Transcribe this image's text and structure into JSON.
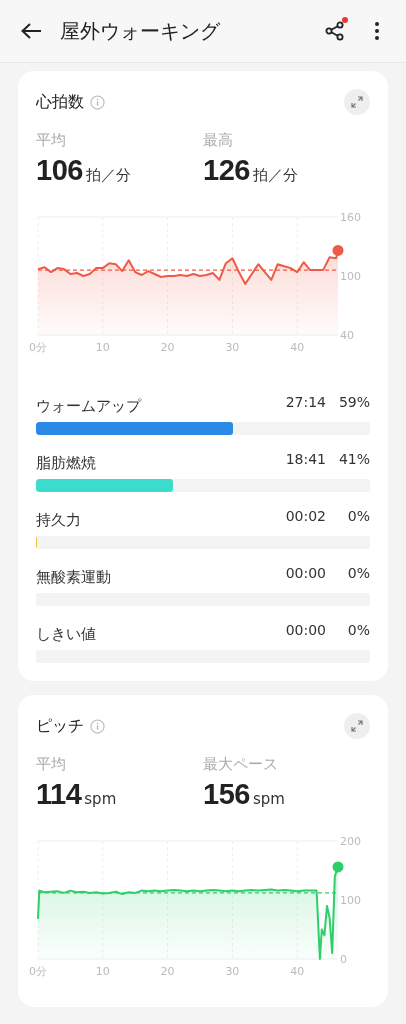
{
  "header": {
    "title": "屋外ウォーキング",
    "share_badge": true
  },
  "cards": [
    {
      "title": "心拍数",
      "stats": [
        {
          "label": "平均",
          "value": "106",
          "unit": "拍／分"
        },
        {
          "label": "最高",
          "value": "126",
          "unit": "拍／分"
        }
      ],
      "chart_data": {
        "type": "area",
        "grid": true,
        "x": [
          0,
          1,
          2,
          3,
          4,
          5,
          6,
          7,
          8,
          9,
          10,
          11,
          12,
          13,
          14,
          15,
          16,
          17,
          18,
          19,
          20,
          21,
          22,
          23,
          24,
          25,
          26,
          27,
          28,
          29,
          30,
          31,
          32,
          33,
          34,
          35,
          36,
          37,
          38,
          39,
          40,
          41,
          42,
          43,
          44,
          45,
          46,
          46.3
        ],
        "xlim": [
          0,
          46.3
        ],
        "ylim": [
          40,
          160
        ],
        "xticks": [
          {
            "value": 0,
            "label": "0分"
          },
          10,
          20,
          30,
          40
        ],
        "yticks": [
          40,
          100,
          160
        ],
        "series": [
          {
            "color": "#ef5a48",
            "values": [
              107,
              109,
              104,
              108,
              107,
              102,
              103,
              100,
              102,
              108,
              108,
              113,
              112,
              105,
              116,
              104,
              101,
              105,
              102,
              99,
              100,
              100,
              101,
              100,
              102,
              100,
              101,
              103,
              96,
              113,
              118,
              104,
              92,
              102,
              112,
              104,
              96,
              112,
              110,
              108,
              104,
              114,
              106,
              106,
              106,
              119,
              118,
              126
            ]
          }
        ],
        "ref_lines": [
          {
            "axis": "y",
            "value": 106
          }
        ]
      },
      "zones": [
        {
          "label": "ウォームアップ",
          "time": "27:14",
          "percent": "59%",
          "level": 0.59,
          "color": "#2a8ae6"
        },
        {
          "label": "脂肪燃焼",
          "time": "18:41",
          "percent": "41%",
          "level": 0.41,
          "color": "#3cdccc"
        },
        {
          "label": "持久力",
          "time": "00:02",
          "percent": "0%",
          "level": 0.001,
          "color": "#f0c040"
        },
        {
          "label": "無酸素運動",
          "time": "00:00",
          "percent": "0%"
        },
        {
          "label": "しきい値",
          "time": "00:00",
          "percent": "0%"
        }
      ]
    },
    {
      "title": "ピッチ",
      "stats": [
        {
          "label": "平均",
          "value": "114",
          "unit": "spm"
        },
        {
          "label": "最大ペース",
          "value": "156",
          "unit": "spm"
        }
      ],
      "chart_data": {
        "type": "area",
        "grid": true,
        "x": [
          0,
          0.2,
          1,
          2,
          3,
          4,
          5,
          6,
          7,
          8,
          9,
          10,
          11,
          12,
          13,
          14,
          15,
          16,
          17,
          18,
          19,
          20,
          21,
          22,
          23,
          24,
          25,
          26,
          27,
          28,
          29,
          30,
          31,
          32,
          33,
          34,
          35,
          36,
          37,
          38,
          39,
          40,
          41,
          42,
          43,
          43.5,
          43.8,
          44.2,
          44.6,
          45,
          45.4,
          45.8,
          46.3
        ],
        "xlim": [
          0,
          46.3
        ],
        "ylim": [
          0,
          200
        ],
        "xticks": [
          {
            "value": 0,
            "label": "0分"
          },
          10,
          20,
          30,
          40
        ],
        "yticks": [
          0,
          100,
          200
        ],
        "series": [
          {
            "color": "#2ecf6a",
            "values": [
              68,
              116,
              113,
              114,
              115,
              112,
              116,
              113,
              114,
              112,
              113,
              111,
              112,
              114,
              110,
              113,
              112,
              116,
              115,
              116,
              115,
              116,
              117,
              116,
              115,
              116,
              115,
              116,
              117,
              116,
              115,
              116,
              115,
              116,
              117,
              116,
              117,
              118,
              116,
              117,
              116,
              115,
              116,
              116,
              116,
              0,
              50,
              40,
              90,
              70,
              10,
              140,
              156
            ]
          }
        ],
        "ref_lines": [
          {
            "axis": "y",
            "value": 112
          }
        ]
      }
    }
  ]
}
